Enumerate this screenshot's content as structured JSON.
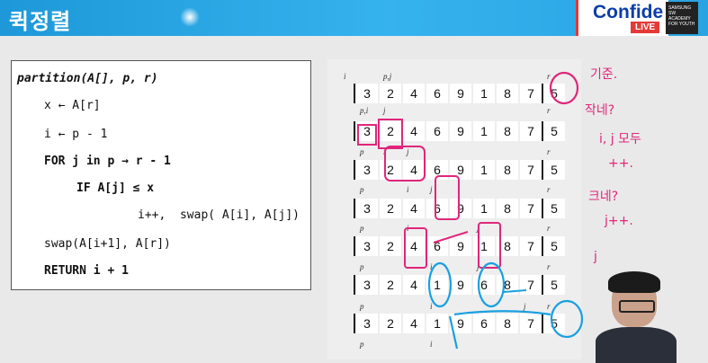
{
  "header": {
    "title": "퀵정렬",
    "brand": "Confide",
    "live": "LIVE",
    "badge": "SAMSUNG SW ACADEMY FOR YOUTH"
  },
  "code": {
    "line1": "partition(A[], p, r)",
    "line2": "x ← A[r]",
    "line3": "i ← p - 1",
    "line4": "FOR j in p → r - 1",
    "line5": "IF A[j] ≤ x",
    "line6": "i++,  swap( A[i], A[j])",
    "line7": "swap(A[i+1], A[r])",
    "line8": "RETURN i + 1"
  },
  "rows": [
    {
      "labels": [
        "i",
        "p,j",
        "",
        "",
        "",
        "",
        "",
        "",
        "r"
      ],
      "values": [
        "3",
        "2",
        "4",
        "6",
        "9",
        "1",
        "8",
        "7",
        "5"
      ]
    },
    {
      "labels": [
        "p,i",
        "j",
        "",
        "",
        "",
        "",
        "",
        "",
        "r"
      ],
      "values": [
        "3",
        "2",
        "4",
        "6",
        "9",
        "1",
        "8",
        "7",
        "5"
      ]
    },
    {
      "labels": [
        "p",
        "i",
        "j",
        "",
        "",
        "",
        "",
        "",
        "r"
      ],
      "values": [
        "3",
        "2",
        "4",
        "6",
        "9",
        "1",
        "8",
        "7",
        "5"
      ]
    },
    {
      "labels": [
        "p",
        "",
        "i",
        "j",
        "",
        "",
        "",
        "",
        "r"
      ],
      "values": [
        "3",
        "2",
        "4",
        "6",
        "9",
        "1",
        "8",
        "7",
        "5"
      ]
    },
    {
      "labels": [
        "p",
        "",
        "i",
        "",
        "",
        "j",
        "",
        "",
        "r"
      ],
      "values": [
        "3",
        "2",
        "4",
        "6",
        "9",
        "1",
        "8",
        "7",
        "5"
      ]
    },
    {
      "labels": [
        "p",
        "",
        "",
        "i",
        "",
        "j",
        "",
        "",
        "r"
      ],
      "values": [
        "3",
        "2",
        "4",
        "1",
        "9",
        "6",
        "8",
        "7",
        "5"
      ]
    },
    {
      "labels": [
        "p",
        "",
        "",
        "i",
        "",
        "",
        "",
        "j",
        "r"
      ],
      "values": [
        "3",
        "2",
        "4",
        "1",
        "9",
        "6",
        "8",
        "7",
        "5"
      ]
    },
    {
      "labels": [
        "p",
        "",
        "",
        "i",
        "",
        "",
        "",
        "",
        ""
      ],
      "values": []
    }
  ],
  "notes": {
    "pivot": "기준.",
    "small": "작네?",
    "ij": "i, j 모두",
    "pp": "++.",
    "big": "크네?",
    "jpp": "j++.",
    "j": "j"
  },
  "colors": {
    "annotation": "#e0267b",
    "blue_annotation": "#1aa0e0",
    "header": "#2aa3e3"
  }
}
